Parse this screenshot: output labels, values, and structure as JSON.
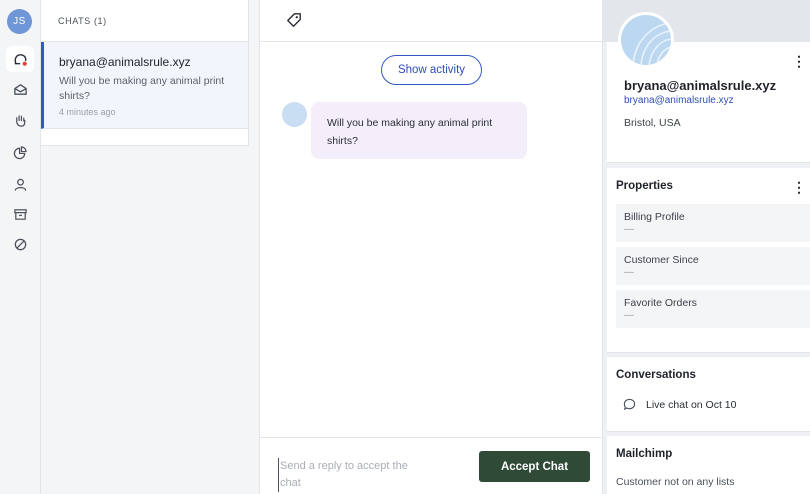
{
  "user": {
    "initials": "JS"
  },
  "rail": {
    "items": [
      {
        "icon": "chat-bubble-icon",
        "active": true
      },
      {
        "icon": "inbox-icon"
      },
      {
        "icon": "hand-icon"
      },
      {
        "icon": "pie-chart-icon"
      },
      {
        "icon": "person-icon"
      },
      {
        "icon": "archive-icon"
      },
      {
        "icon": "blocked-icon"
      }
    ]
  },
  "chat_list": {
    "header": "CHATS",
    "count": "(1)",
    "items": [
      {
        "name": "bryana@animalsrule.xyz",
        "preview": "Will you be making any animal print shirts?",
        "time": "4 minutes ago"
      }
    ]
  },
  "conversation": {
    "show_activity_label": "Show activity",
    "messages": [
      {
        "text": "Will you be making any animal print shirts?"
      }
    ],
    "reply_placeholder": "Send a reply to accept the chat",
    "accept_label": "Accept Chat"
  },
  "profile": {
    "name": "bryana@animalsrule.xyz",
    "email": "bryana@animalsrule.xyz",
    "location": "Bristol, USA",
    "menu_glyph": "⋮"
  },
  "properties": {
    "title": "Properties",
    "menu_glyph": "⋮",
    "items": [
      {
        "label": "Billing Profile",
        "value": "—"
      },
      {
        "label": "Customer Since",
        "value": "—"
      },
      {
        "label": "Favorite Orders",
        "value": "—"
      }
    ]
  },
  "conversations": {
    "title": "Conversations",
    "items": [
      {
        "label": "Live chat on Oct 10"
      }
    ]
  },
  "mailchimp": {
    "title": "Mailchimp",
    "status": "Customer not on any lists"
  },
  "colors": {
    "accent": "#3457c4",
    "accept_button": "#2f4a37",
    "bubble": "#f4eefb",
    "avatar": "#6f96d6"
  }
}
